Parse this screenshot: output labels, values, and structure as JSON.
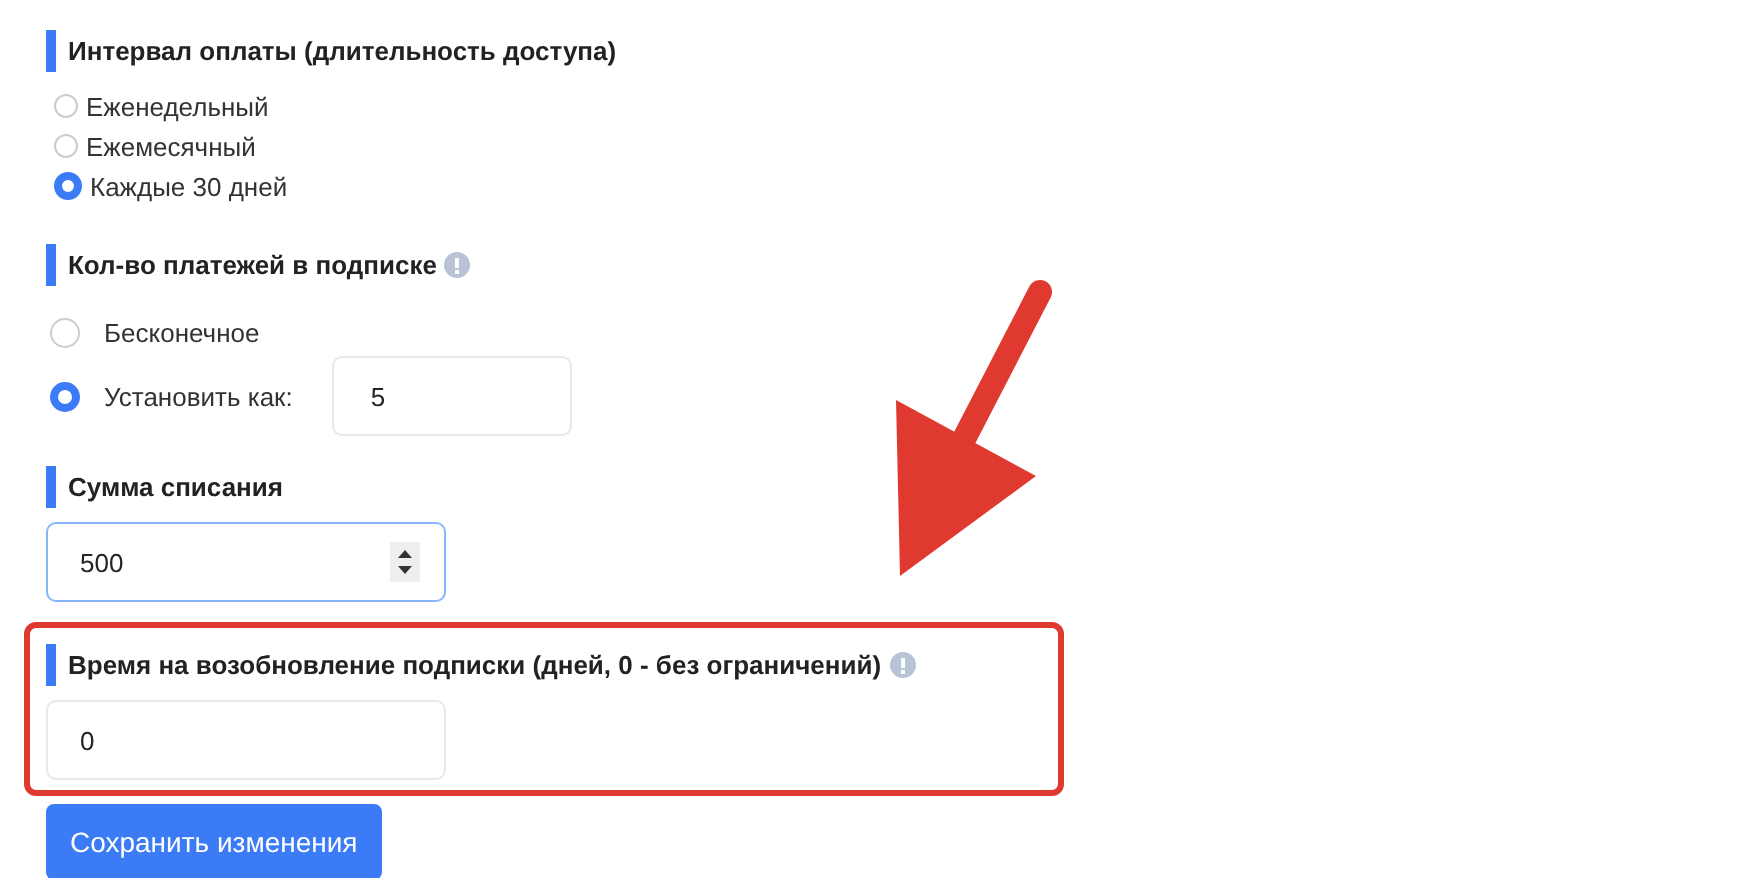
{
  "sections": [
    {
      "kind": "radios",
      "title": "Интервал оплаты (длительность доступа)",
      "info": false,
      "options": [
        {
          "label": "Еженедельный",
          "selected": false
        },
        {
          "label": "Ежемесячный",
          "selected": false
        },
        {
          "label": "Каждые 30 дней",
          "selected": true
        }
      ]
    },
    {
      "kind": "radios-spaced",
      "title": "Кол-во платежей в подписке",
      "info": true,
      "options": [
        {
          "label": "Бесконечное",
          "selected": false
        },
        {
          "label": "Установить как:",
          "selected": true,
          "value": "5"
        }
      ]
    },
    {
      "kind": "number",
      "title": "Сумма списания",
      "info": false,
      "value": "500",
      "highlighted": false
    },
    {
      "kind": "text",
      "title": "Время на возобновление подписки (дней, 0 - без ограничений)",
      "info": true,
      "value": "0",
      "highlighted": true
    }
  ],
  "button": "Сохранить изменения"
}
